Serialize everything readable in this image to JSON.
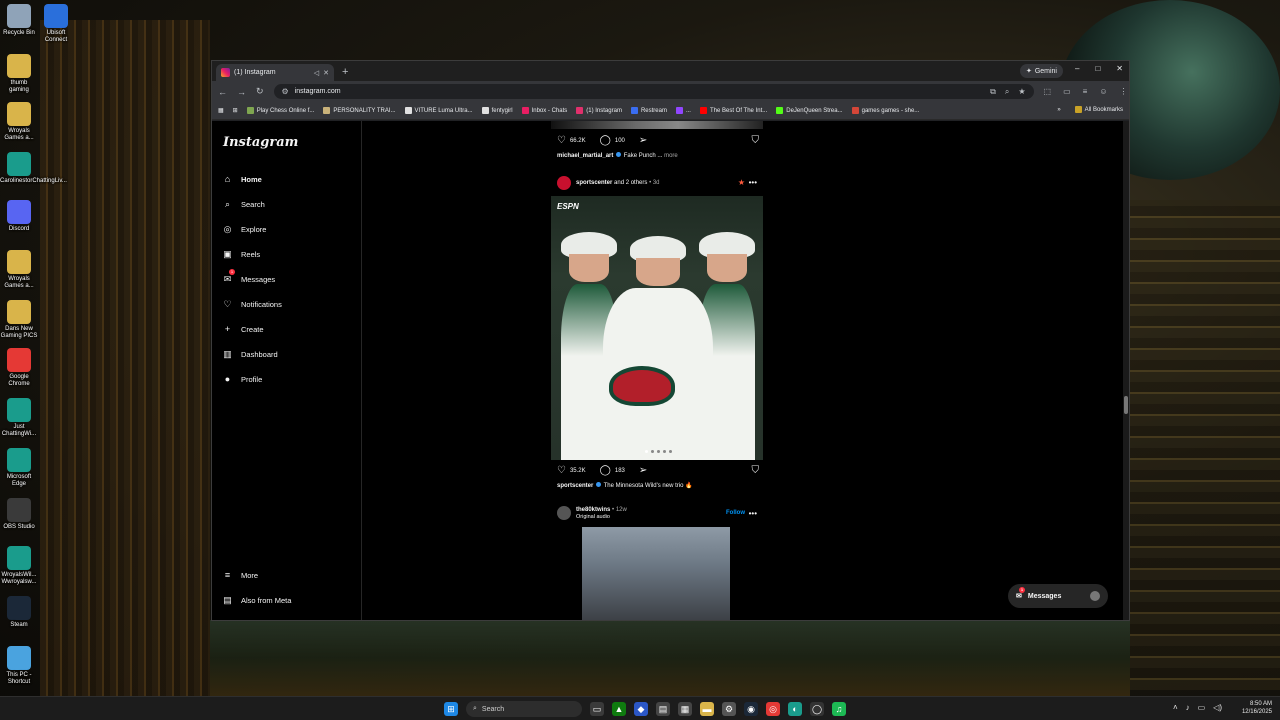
{
  "desktop": {
    "icons": [
      {
        "label": "Recycle Bin",
        "icon": "recycle-bin-icon",
        "color": "#8fa3b8"
      },
      {
        "label": "Ubisoft Connect",
        "icon": "ubisoft-icon",
        "color": "#2a6fdb"
      },
      {
        "label": "thumb gaming",
        "icon": "folder-icon",
        "color": "#d9b44a"
      },
      {
        "label": "Wroyals Games a...",
        "icon": "folder-icon",
        "color": "#d9b44a"
      },
      {
        "label": "CarolinestorChattingLiv...",
        "icon": "edge-icon",
        "color": "#1a9c8c"
      },
      {
        "label": "Discord",
        "icon": "discord-icon",
        "color": "#5865f2"
      },
      {
        "label": "Wroyals Games a...",
        "icon": "folder-icon",
        "color": "#d9b44a"
      },
      {
        "label": "Dans New Gaming PICS",
        "icon": "folder-icon",
        "color": "#d9b44a"
      },
      {
        "label": "Google Chrome",
        "icon": "chrome-icon",
        "color": "#e53935"
      },
      {
        "label": "Just ChattingWi...",
        "icon": "edge-icon",
        "color": "#1a9c8c"
      },
      {
        "label": "Microsoft Edge",
        "icon": "edge-icon",
        "color": "#1a9c8c"
      },
      {
        "label": "OBS Studio",
        "icon": "obs-icon",
        "color": "#3a3a3a"
      },
      {
        "label": "WroyalsWil... Wwroyalsw...",
        "icon": "edge-icon",
        "color": "#1a9c8c"
      },
      {
        "label": "Steam",
        "icon": "steam-icon",
        "color": "#1b2838"
      },
      {
        "label": "This PC - Shortcut",
        "icon": "pc-icon",
        "color": "#4aa3df"
      }
    ]
  },
  "browser": {
    "tab_title": "(1) Instagram",
    "new_tab": "+",
    "gemini_label": "Gemini",
    "url": "instagram.com",
    "window_controls": [
      "–",
      "□",
      "✕"
    ],
    "bookmarks": [
      {
        "label": "Play Chess Online f...",
        "color": "#7fa650"
      },
      {
        "label": "PERSONALITY TRAI...",
        "color": "#c9b27a"
      },
      {
        "label": "VITURE Luma Ultra...",
        "color": "#e0e0e0"
      },
      {
        "label": "fentygirl",
        "color": "#e0e0e0"
      },
      {
        "label": "Inbox - Chats",
        "color": "#e91e63"
      },
      {
        "label": "(1) Instagram",
        "color": "#e1306c"
      },
      {
        "label": "Restream",
        "color": "#3a6df0"
      },
      {
        "label": "...",
        "color": "#9146ff"
      },
      {
        "label": "The Best Of The Int...",
        "color": "#ff0000"
      },
      {
        "label": "DeJenQueen Strea...",
        "color": "#53fc18"
      },
      {
        "label": "games games - she...",
        "color": "#d44638"
      }
    ],
    "all_bookmarks": "All Bookmarks"
  },
  "instagram": {
    "logo": "Instagram",
    "nav": [
      {
        "label": "Home",
        "icon": "home-icon",
        "glyph": "⌂"
      },
      {
        "label": "Search",
        "icon": "search-icon",
        "glyph": "⌕"
      },
      {
        "label": "Explore",
        "icon": "compass-icon",
        "glyph": "◎"
      },
      {
        "label": "Reels",
        "icon": "reels-icon",
        "glyph": "▣"
      },
      {
        "label": "Messages",
        "icon": "messenger-icon",
        "glyph": "✉"
      },
      {
        "label": "Notifications",
        "icon": "heart-icon",
        "glyph": "♡"
      },
      {
        "label": "Create",
        "icon": "plus-icon",
        "glyph": "+"
      },
      {
        "label": "Dashboard",
        "icon": "dashboard-icon",
        "glyph": "▥"
      },
      {
        "label": "Profile",
        "icon": "profile-icon",
        "glyph": "●"
      }
    ],
    "messages_badge": "1",
    "more": "More",
    "also_from_meta": "Also from Meta",
    "post1": {
      "likes": "66.2K",
      "comments": "100",
      "username": "michael_martial_art",
      "caption": "Fake Punch ...",
      "more": "more"
    },
    "post2": {
      "username": "sportscenter",
      "others": "and 2 others",
      "time": "3d",
      "image_badge": "ESPN",
      "likes": "35.2K",
      "comments": "183",
      "caption_user": "sportscenter",
      "caption": "The Minnesota Wild's new trio 🔥"
    },
    "post3": {
      "username": "the80ktwins",
      "time": "12w",
      "subtitle": "Original audio",
      "follow": "Follow"
    },
    "messages_pill": {
      "label": "Messages",
      "badge": "1"
    }
  },
  "taskbar": {
    "search": "Search",
    "time": "8:50 AM",
    "date": "12/16/2025"
  }
}
